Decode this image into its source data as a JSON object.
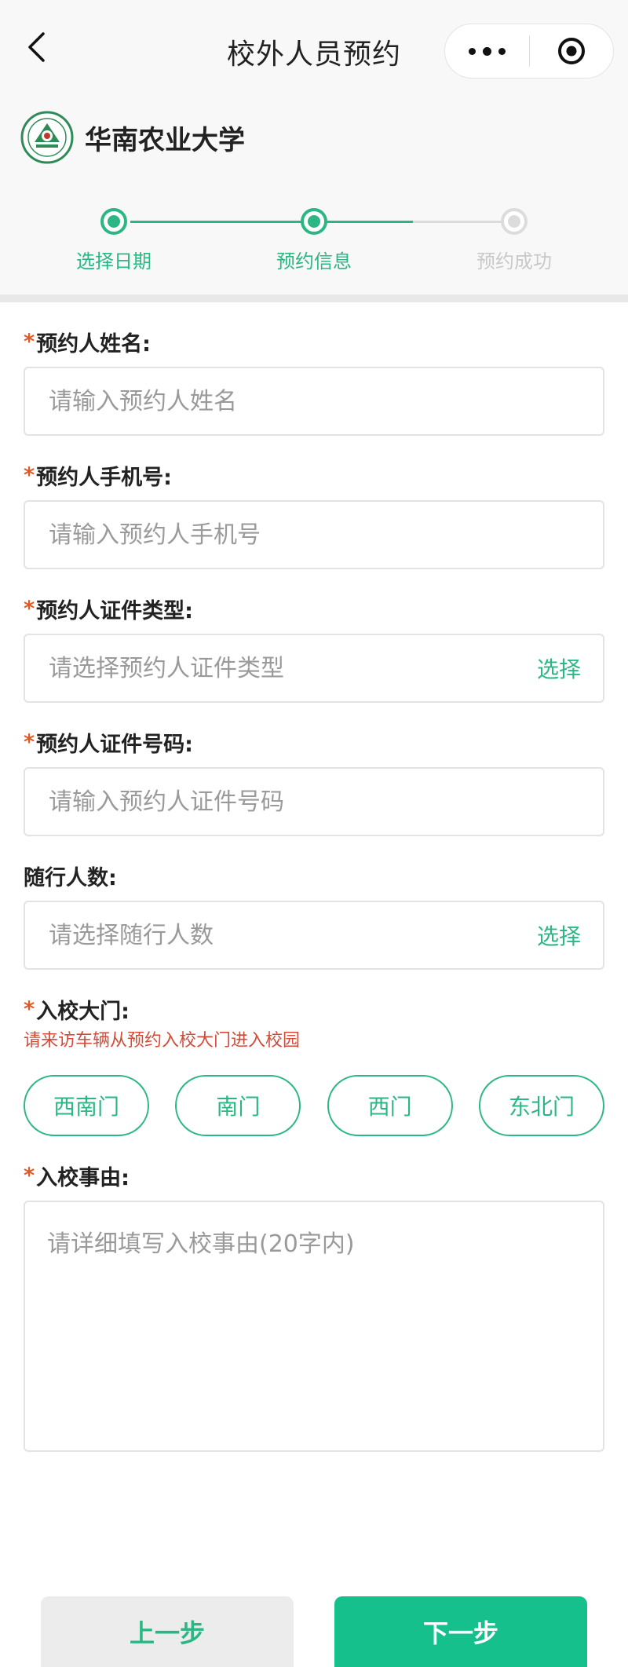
{
  "nav": {
    "title": "校外人员预约",
    "back_icon": "chevron-left-icon",
    "more_icon": "more-dots-icon",
    "close_icon": "target-close-icon"
  },
  "header": {
    "school": "华南农业大学"
  },
  "steps": [
    {
      "label": "选择日期",
      "state": "done"
    },
    {
      "label": "预约信息",
      "state": "active"
    },
    {
      "label": "预约成功",
      "state": "pending"
    }
  ],
  "form": {
    "name": {
      "label": "预约人姓名:",
      "placeholder": "请输入预约人姓名",
      "value": ""
    },
    "phone": {
      "label": "预约人手机号:",
      "placeholder": "请输入预约人手机号",
      "value": ""
    },
    "id_type": {
      "label": "预约人证件类型:",
      "placeholder": "请选择预约人证件类型",
      "pick": "选择"
    },
    "id_number": {
      "label": "预约人证件号码:",
      "placeholder": "请输入预约人证件号码",
      "value": ""
    },
    "companions": {
      "label": "随行人数:",
      "placeholder": "请选择随行人数",
      "pick": "选择"
    },
    "gate": {
      "label": "入校大门:",
      "note": "请来访车辆从预约入校大门进入校园",
      "options": [
        "西南门",
        "南门",
        "西门",
        "东北门"
      ]
    },
    "reason": {
      "label": "入校事由:",
      "placeholder": "请详细填写入校事由(20字内)"
    }
  },
  "actions": {
    "prev": "上一步",
    "next": "下一步"
  },
  "colors": {
    "accent": "#2bb784",
    "button": "#16c08d",
    "required": "#e05a28",
    "note": "#d44b3a"
  }
}
